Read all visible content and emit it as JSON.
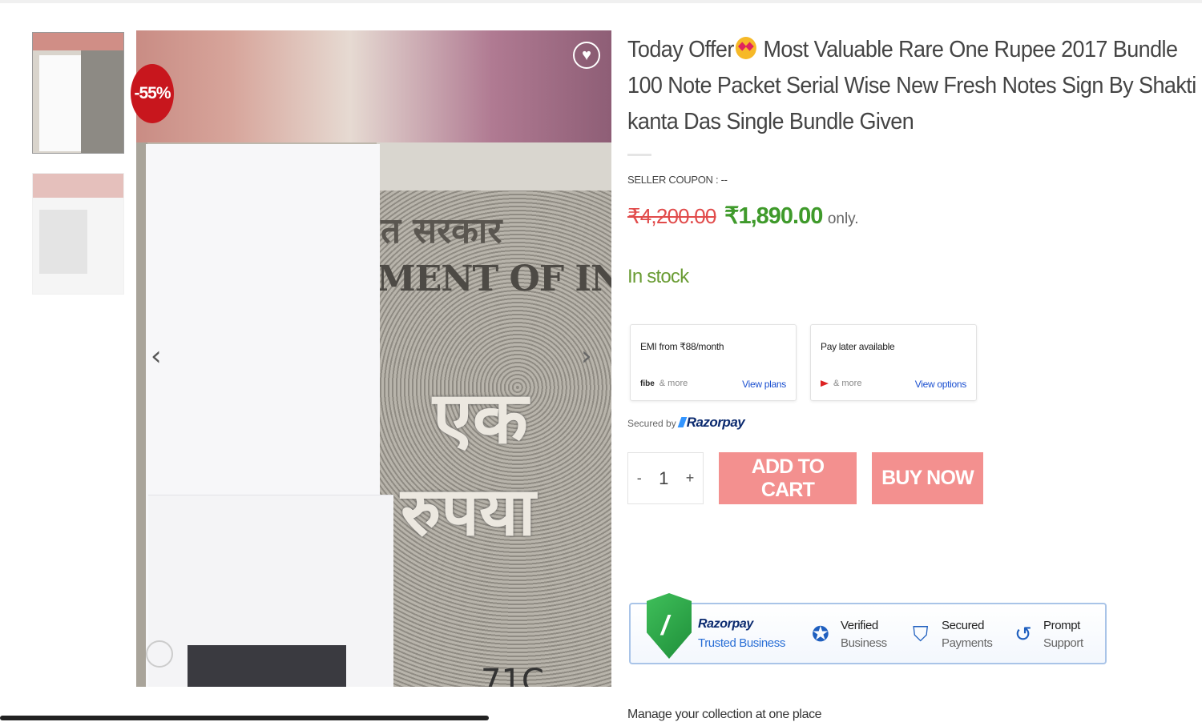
{
  "gallery": {
    "discount_badge": "-55%",
    "wishlist_icon": "heart-icon",
    "prev_icon": "chevron-left-icon",
    "next_icon": "chevron-right-icon",
    "prev_symbol": "‹",
    "next_symbol": "›",
    "wishlist_symbol": "♥",
    "hindi_text": "त सरकार",
    "note_text": "MENT OF INDIA",
    "ek_text": "एक",
    "rupaya_text": "रुपया",
    "serial_text": "71C"
  },
  "product": {
    "title_part1": "Today Offer",
    "title_part2": "Most Valuable Rare One Rupee 2017 Bundle 100 Note Packet Serial Wise New Fresh Notes Sign By Shakti kanta Das Single Bundle Given",
    "seller_coupon": "SELLER COUPON : --",
    "old_price": "₹4,200.00",
    "new_price": "₹1,890.00",
    "price_suffix": "only.",
    "stock_status": "In stock"
  },
  "payment": {
    "emi_title": "EMI from ₹88/month",
    "emi_logo": "fibe",
    "emi_more": "& more",
    "emi_link": "View plans",
    "paylater_title": "Pay later available",
    "paylater_more": "& more",
    "paylater_link": "View options",
    "secured_by": "Secured by",
    "razorpay": "Razorpay"
  },
  "cart": {
    "minus": "-",
    "quantity": "1",
    "plus": "+",
    "add_to_cart": "ADD TO CART",
    "buy_now": "BUY NOW"
  },
  "trust": {
    "brand": "Razorpay",
    "brand_sub": "Trusted Business",
    "features": [
      {
        "line1": "Verified",
        "line2": "Business",
        "icon": "verified-badge-icon"
      },
      {
        "line1": "Secured",
        "line2": "Payments",
        "icon": "shield-icon"
      },
      {
        "line1": "Prompt",
        "line2": "Support",
        "icon": "support-clock-icon"
      }
    ]
  },
  "footer": {
    "manage_text": "Manage your collection at one place"
  },
  "colors": {
    "badge_red": "#c8161d",
    "old_price_red": "#e14b4b",
    "new_price_green": "#3f9a2b",
    "stock_green": "#6a9c34",
    "button_pink": "#f3908f",
    "link_blue": "#1a4fd0"
  }
}
